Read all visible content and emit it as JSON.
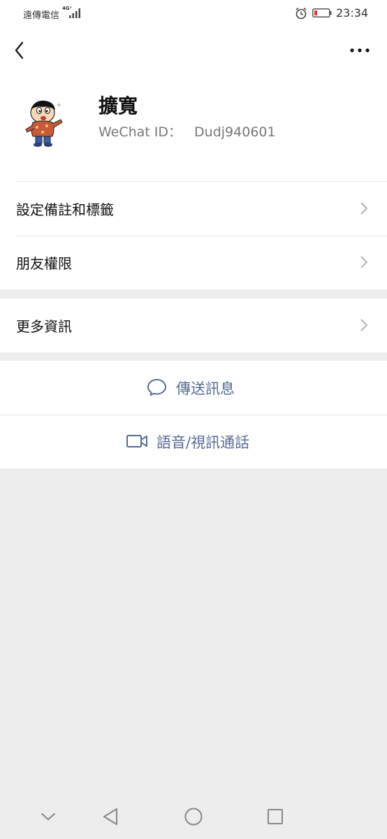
{
  "status_bar": {
    "carrier": "遠傳電信",
    "network": "4G⁺",
    "time": "23:34"
  },
  "header": {
    "back_icon": "chevron-left-icon",
    "more_icon": "more-dots-icon"
  },
  "profile": {
    "name": "擴寬",
    "wechat_id_label": "WeChat ID：",
    "wechat_id": "Dudj940601"
  },
  "menu": {
    "remark_tags": "設定備註和標籤",
    "friend_permissions": "朋友權限",
    "more_info": "更多資訊"
  },
  "actions": {
    "send_message": "傳送訊息",
    "voice_video_call": "語音/視訊通話"
  },
  "colors": {
    "accent": "#576b95",
    "background": "#ededed",
    "battery_low": "#e23a3a"
  }
}
